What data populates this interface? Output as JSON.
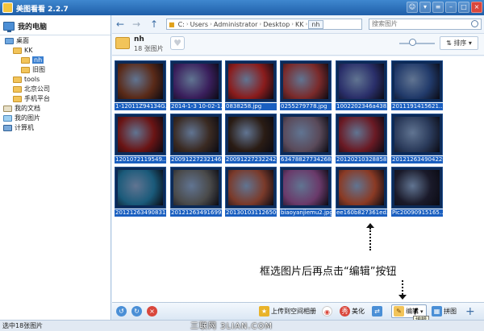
{
  "app": {
    "title": "美图看看 2.2.7"
  },
  "sidebar": {
    "root_label": "我的电脑",
    "items": [
      {
        "label": "桌面"
      },
      {
        "label": "KK"
      },
      {
        "label": "nh"
      },
      {
        "label": "旧图"
      },
      {
        "label": "tools"
      },
      {
        "label": "北京公司"
      },
      {
        "label": "手机平台"
      },
      {
        "label": "我的文档"
      },
      {
        "label": "我的图片"
      },
      {
        "label": "计算机"
      }
    ]
  },
  "address": {
    "crumbs": [
      "C:",
      "Users",
      "Administrator",
      "Desktop",
      "KK",
      "nh"
    ]
  },
  "search": {
    "placeholder": "搜索图片"
  },
  "folder": {
    "name": "nh",
    "count": "18 张图片",
    "sort_label": "排序"
  },
  "thumbnails": [
    {
      "caption": "1-12011Z94134G...",
      "color": "#5a2a18"
    },
    {
      "caption": "2014-1-3 10-02-1...",
      "color": "#3a1f5c"
    },
    {
      "caption": "0838258.jpg",
      "color": "#8a1c1c"
    },
    {
      "caption": "0255279778.jpg",
      "color": "#7a2a2a"
    },
    {
      "caption": "1002202346a438...",
      "color": "#2a2f6a"
    },
    {
      "caption": "2011191415621...",
      "color": "#213a6a"
    },
    {
      "caption": "1201072119549...",
      "color": "#6a1414"
    },
    {
      "caption": "200912272321461...",
      "color": "#3a2a22"
    },
    {
      "caption": "200912272322421...",
      "color": "#2a1c14"
    },
    {
      "caption": "634788277342680...",
      "color": "#5a4a5a"
    },
    {
      "caption": "201202103288587...",
      "color": "#6a1a24"
    },
    {
      "caption": "201212634904220...",
      "color": "#2a3a5a"
    },
    {
      "caption": "201212634908311...",
      "color": "#1a5a7a"
    },
    {
      "caption": "201212634916992...",
      "color": "#4a4a4a"
    },
    {
      "caption": "201301031126500...",
      "color": "#7a3a2a"
    },
    {
      "caption": "biaoyanjiemu2.jpg",
      "color": "#6a3a6a"
    },
    {
      "caption": "ee160b827361ed...",
      "color": "#8a3a24"
    },
    {
      "caption": "Pic20090915165...",
      "color": "#1a1a2a"
    }
  ],
  "annotation": {
    "text": "框选图片后再点击“编辑”按钮"
  },
  "bottombar": {
    "upload_label": "上传到空间相册",
    "beautify_label": "美化",
    "edit_label": "编辑",
    "stitch_label": "拼图",
    "tooltip": "编辑"
  },
  "status": {
    "text": "选中18张图片"
  },
  "watermark": {
    "text": "三联网 3LIAN.COM"
  }
}
